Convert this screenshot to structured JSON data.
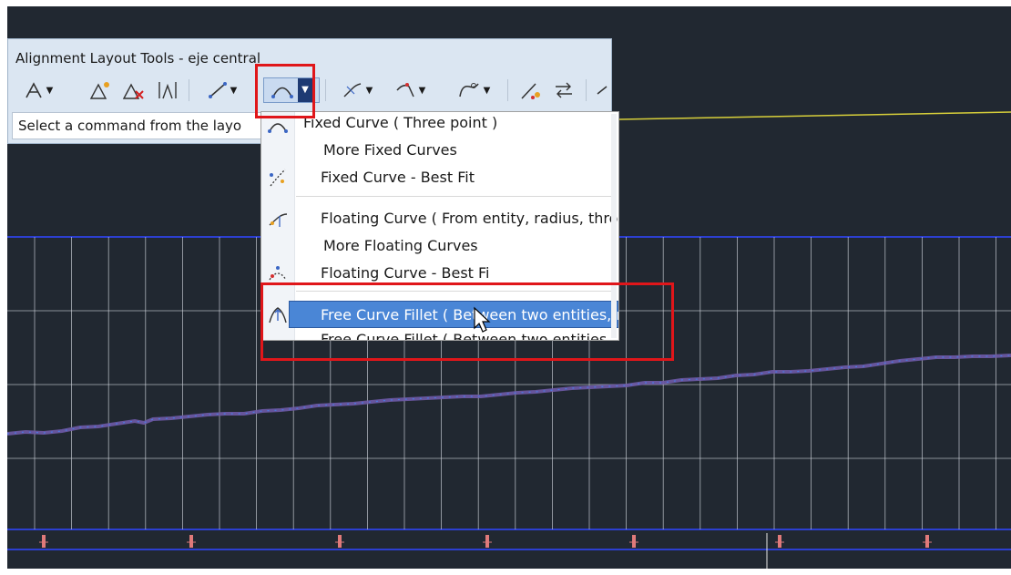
{
  "window": {
    "title": "Alignment Layout Tools - eje central"
  },
  "toolbar": {
    "status_text": "Select a command from the layo",
    "buttons": [
      {
        "icon": "tangent-creation-icon"
      },
      {
        "icon": "insert-pi-icon"
      },
      {
        "icon": "delete-pi-icon"
      },
      {
        "icon": "break-apart-pi-icon"
      },
      {
        "icon": "line-tools-icon"
      },
      {
        "icon": "curve-tools-icon"
      },
      {
        "icon": "line-curve-tools-icon"
      },
      {
        "icon": "curve-line-tools-icon"
      },
      {
        "icon": "spiral-tools-icon"
      },
      {
        "icon": "sub-entity-edit-icon"
      },
      {
        "icon": "reverse-direction-icon"
      }
    ]
  },
  "menu": {
    "items": [
      {
        "label": "Fixed Curve ( Three point )",
        "icon": "fixed-curve-three-point-icon"
      },
      {
        "label": "More Fixed Curves",
        "icon": ""
      },
      {
        "label": "Fixed Curve - Best Fit",
        "icon": "fixed-curve-best-fit-icon"
      },
      {
        "label": "Floating Curve ( From entity, radius, thro",
        "icon": "floating-curve-icon"
      },
      {
        "label": "More Floating Curves",
        "icon": ""
      },
      {
        "label": "Floating Curve - Best Fi",
        "icon": "floating-curve-best-fit-icon"
      },
      {
        "label": "Free Curve Fillet ( Between two entities, r",
        "icon": "free-curve-fillet-icon",
        "highlighted": true
      },
      {
        "label": "Free Curve Fillet ( Between two entities",
        "icon": "free-curve-fillet-2-icon"
      }
    ]
  },
  "colors": {
    "canvas_bg": "#212831",
    "highlight": "#4a86d6",
    "annotation_red": "#e0161a",
    "profile_line": "#6e5aa8",
    "grid_line": "#cfd4dc"
  }
}
